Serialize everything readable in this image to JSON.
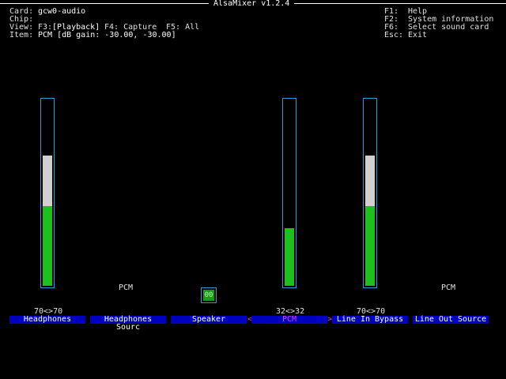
{
  "app": {
    "title": "AlsaMixer v1.2.4"
  },
  "info": {
    "card_label": "Card:",
    "card_value": "gcw0-audio",
    "chip_label": "Chip:",
    "chip_value": "",
    "view_label": "View:",
    "view_f3": "F3:",
    "view_playback": "[Playback]",
    "view_f4": "F4: Capture",
    "view_f5": "F5: All",
    "item_label": "Item:",
    "item_value": "PCM [dB gain: -30.00, -30.00]"
  },
  "help": {
    "f1_key": "F1:",
    "f1_text": "Help",
    "f2_key": "F2:",
    "f2_text": "System information",
    "f6_key": "F6:",
    "f6_text": "Select sound card",
    "esc_key": "Esc:",
    "esc_text": "Exit"
  },
  "controls": [
    {
      "name": "Headphones",
      "value_text": "70<>70",
      "white_level": 0.7,
      "green_level": 0.43
    },
    {
      "name": "Headphones Sourc",
      "enum_value": "PCM"
    },
    {
      "name": "Speaker",
      "switch_text": "00"
    },
    {
      "name": "PCM",
      "value_text": "32<>32",
      "green_level": 0.31,
      "selected": true
    },
    {
      "name": "Line In Bypass",
      "value_text": "70<>70",
      "white_level": 0.7,
      "green_level": 0.43
    },
    {
      "name": "Line Out Source",
      "enum_value": "PCM"
    }
  ],
  "nav": {
    "left_arrow": "<",
    "right_arrow": ">"
  },
  "colors": {
    "background": "#000000",
    "label_bg": "#0000c0",
    "meter_green": "#1ec01e",
    "meter_white": "#d0d0d0",
    "frame": "#3399cc",
    "selected_text": "#e040e0"
  }
}
